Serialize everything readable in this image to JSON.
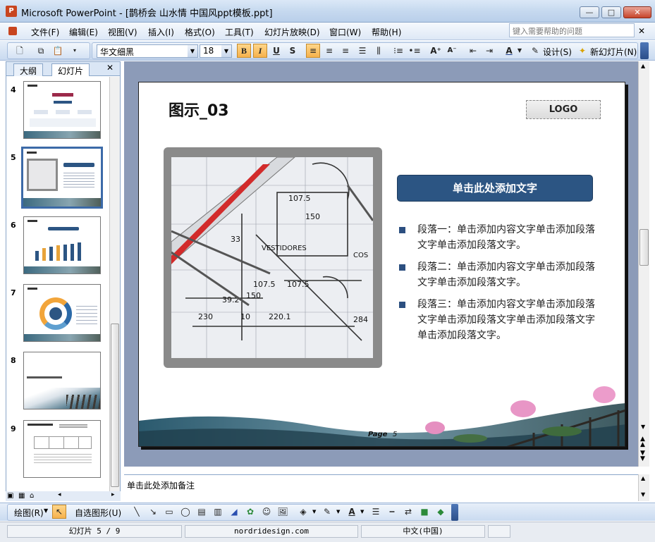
{
  "window": {
    "title": "Microsoft PowerPoint - [鹊桥会 山水情 中国风ppt模板.ppt]",
    "app_icon": "P",
    "controls": [
      "—",
      "□",
      "✕"
    ]
  },
  "menu": {
    "items": [
      "文件(F)",
      "编辑(E)",
      "视图(V)",
      "插入(I)",
      "格式(O)",
      "工具(T)",
      "幻灯片放映(D)",
      "窗口(W)",
      "帮助(H)"
    ],
    "help_placeholder": "键入需要帮助的问题",
    "close_doc": "✕"
  },
  "toolbar": {
    "font_name": "华文细黑",
    "font_size": "18",
    "bold": "B",
    "italic": "I",
    "underline": "U",
    "shadow": "S",
    "design_label": "设计(S)",
    "new_slide_label": "新幻灯片(N)"
  },
  "left_pane": {
    "tabs": [
      "大纲",
      "幻灯片"
    ],
    "close": "✕",
    "slide_numbers": [
      "4",
      "5",
      "6",
      "7",
      "8",
      "9"
    ],
    "selected_slide": "5"
  },
  "slide": {
    "title": "图示_03",
    "logo": "LOGO",
    "header_box": "单击此处添加文字",
    "paragraphs": [
      "段落一：单击添加内容文字单击添加段落文字单击添加段落文字。",
      "段落二：单击添加内容文字单击添加段落文字单击添加段落文字。",
      "段落三：单击添加内容文字单击添加段落文字单击添加段落文字单击添加段落文字单击添加段落文字。"
    ],
    "page_label": "Page",
    "page_number": "5",
    "image_labels": [
      "107.5",
      "150",
      "33",
      "VESTIDORES",
      "COS",
      "107.5",
      "107.5",
      "150",
      "39.2",
      "230",
      "10",
      "220.1",
      "284"
    ]
  },
  "notes": {
    "placeholder": "单击此处添加备注"
  },
  "drawing_toolbar": {
    "draw_label": "绘图(R)",
    "autoshapes_label": "自选图形(U)"
  },
  "status": {
    "slide_info": "幻灯片 5 / 9",
    "design": "nordridesign.com",
    "language": "中文(中国)"
  },
  "colors": {
    "accent": "#2c5583",
    "canvas_bg": "#8c9bb8",
    "selection": "#3c6aa8"
  }
}
